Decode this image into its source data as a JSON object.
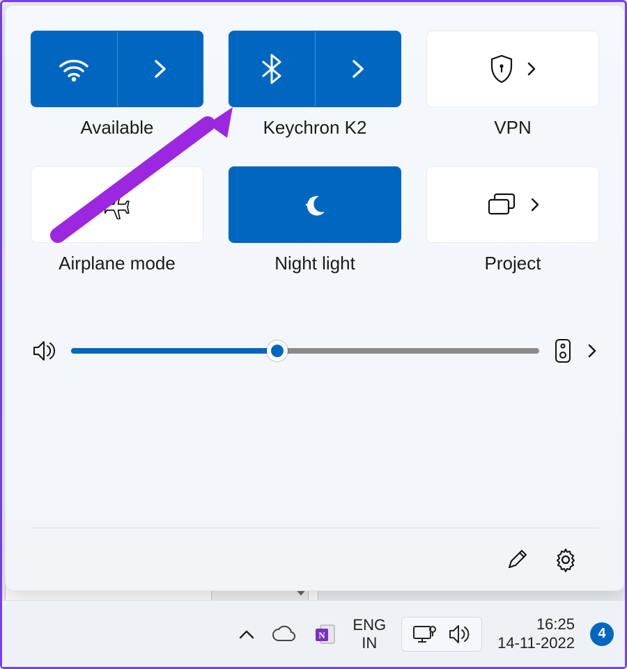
{
  "quick_settings": {
    "tiles": [
      {
        "id": "wifi",
        "label": "Available",
        "active": true,
        "has_more": true
      },
      {
        "id": "bluetooth",
        "label": "Keychron K2",
        "active": true,
        "has_more": true
      },
      {
        "id": "vpn",
        "label": "VPN",
        "active": false,
        "has_more": true
      },
      {
        "id": "airplane",
        "label": "Airplane mode",
        "active": false,
        "has_more": false
      },
      {
        "id": "nightlight",
        "label": "Night light",
        "active": true,
        "has_more": false
      },
      {
        "id": "project",
        "label": "Project",
        "active": false,
        "has_more": true
      }
    ],
    "volume_percent": 44
  },
  "taskbar": {
    "lang_top": "ENG",
    "lang_bottom": "IN",
    "time": "16:25",
    "date": "14-11-2022",
    "notification_count": "4"
  },
  "colors": {
    "accent": "#0067c0",
    "annotation": "#9b27e0"
  }
}
